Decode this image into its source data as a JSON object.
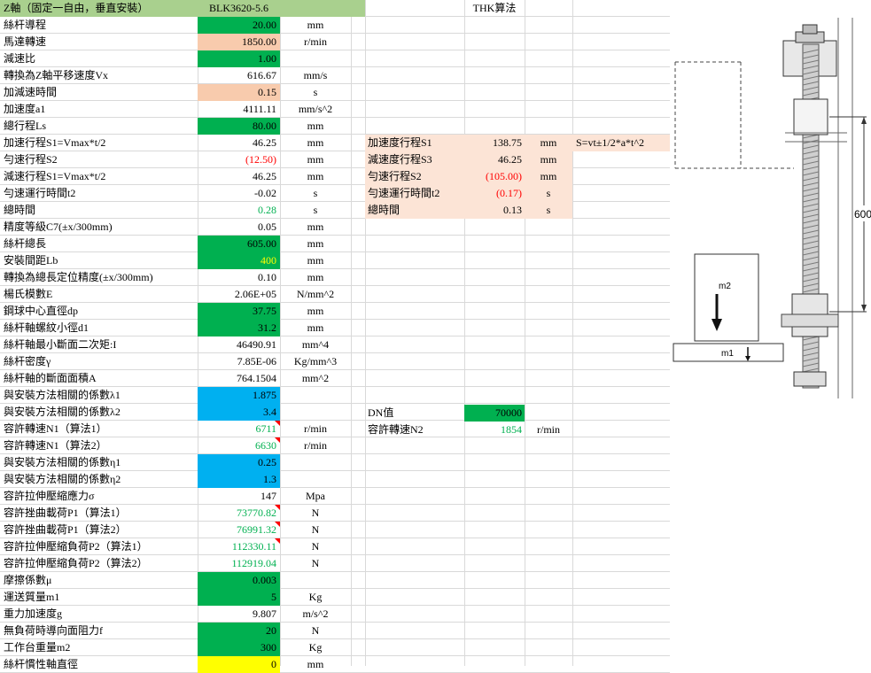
{
  "header": {
    "title": "Z軸（固定一自由，垂直安裝）",
    "model": "BLK3620-5.6",
    "thk_title": "THK算法"
  },
  "left_rows": [
    {
      "label": "絲杆導程",
      "value": "20.00",
      "unit": "mm",
      "style": "green"
    },
    {
      "label": "馬達轉速",
      "value": "1850.00",
      "unit": "r/min",
      "style": "orange"
    },
    {
      "label": "減速比",
      "value": "1.00",
      "unit": "",
      "style": "green"
    },
    {
      "label": "轉換為Z軸平移速度Vx",
      "value": "616.67",
      "unit": "mm/s",
      "style": ""
    },
    {
      "label": "加減速時間",
      "value": "0.15",
      "unit": "s",
      "style": "orange"
    },
    {
      "label": "加速度a1",
      "value": "4111.11",
      "unit": "mm/s^2",
      "style": ""
    },
    {
      "label": "總行程Ls",
      "value": "80.00",
      "unit": "mm",
      "style": "green"
    },
    {
      "label": "加速行程S1=Vmax*t/2",
      "value": "46.25",
      "unit": "mm",
      "style": ""
    },
    {
      "label": "勻速行程S2",
      "value": "(12.50)",
      "unit": "mm",
      "style": "red"
    },
    {
      "label": "減速行程S1=Vmax*t/2",
      "value": "46.25",
      "unit": "mm",
      "style": ""
    },
    {
      "label": "勻速運行時間t2",
      "value": "-0.02",
      "unit": "s",
      "style": ""
    },
    {
      "label": "總時間",
      "value": "0.28",
      "unit": "s",
      "style": "tgreen"
    },
    {
      "label": "精度等級C7(±x/300mm)",
      "value": "0.05",
      "unit": "mm",
      "style": ""
    },
    {
      "label": "絲杆總長",
      "value": "605.00",
      "unit": "mm",
      "style": "green"
    },
    {
      "label": "安裝間距Lb",
      "value": "400",
      "unit": "mm",
      "style": "green-yellow"
    },
    {
      "label": "轉換為總長定位精度(±x/300mm)",
      "value": "0.10",
      "unit": "mm",
      "style": ""
    },
    {
      "label": "楊氏模數E",
      "value": "2.06E+05",
      "unit": "N/mm^2",
      "style": ""
    },
    {
      "label": "鋼球中心直徑dp",
      "value": "37.75",
      "unit": "mm",
      "style": "green"
    },
    {
      "label": "絲杆軸螺紋小徑d1",
      "value": "31.2",
      "unit": "mm",
      "style": "green"
    },
    {
      "label": "絲杆軸最小斷面二次矩:I",
      "value": "46490.91",
      "unit": "mm^4",
      "style": ""
    },
    {
      "label": "絲杆密度γ",
      "value": "7.85E-06",
      "unit": "Kg/mm^3",
      "style": ""
    },
    {
      "label": "絲杆軸的斷面面積A",
      "value": "764.1504",
      "unit": "mm^2",
      "style": ""
    },
    {
      "label": "與安裝方法相關的係數λ1",
      "value": "1.875",
      "unit": "",
      "style": "blue"
    },
    {
      "label": "與安裝方法相關的係數λ2",
      "value": "3.4",
      "unit": "",
      "style": "blue"
    },
    {
      "label": "容許轉速N1（算法1）",
      "value": "6711",
      "unit": "r/min",
      "style": "tgreen-tri"
    },
    {
      "label": "容許轉速N1（算法2）",
      "value": "6630",
      "unit": "r/min",
      "style": "tgreen-tri"
    },
    {
      "label": "與安裝方法相關的係數η1",
      "value": "0.25",
      "unit": "",
      "style": "blue"
    },
    {
      "label": "與安裝方法相關的係數η2",
      "value": "1.3",
      "unit": "",
      "style": "blue"
    },
    {
      "label": "容許拉伸壓縮應力σ",
      "value": "147",
      "unit": "Mpa",
      "style": ""
    },
    {
      "label": "容許挫曲載荷P1（算法1）",
      "value": "73770.82",
      "unit": "N",
      "style": "tgreen-tri"
    },
    {
      "label": "容許挫曲載荷P1（算法2）",
      "value": "76991.32",
      "unit": "N",
      "style": "tgreen-tri"
    },
    {
      "label": "容許拉伸壓縮負荷P2（算法1）",
      "value": "112330.11",
      "unit": "N",
      "style": "tgreen-tri"
    },
    {
      "label": "容許拉伸壓縮負荷P2（算法2）",
      "value": "112919.04",
      "unit": "N",
      "style": "tgreen"
    },
    {
      "label": "摩擦係數μ",
      "value": "0.003",
      "unit": "",
      "style": "green"
    },
    {
      "label": "運送質量m1",
      "value": "5",
      "unit": "Kg",
      "style": "green"
    },
    {
      "label": "重力加速度g",
      "value": "9.807",
      "unit": "m/s^2",
      "style": ""
    },
    {
      "label": "無負荷時導向面阻力f",
      "value": "20",
      "unit": "N",
      "style": "green"
    },
    {
      "label": "工作台重量m2",
      "value": "300",
      "unit": "Kg",
      "style": "green"
    },
    {
      "label": "絲杆慣性軸直徑",
      "value": "0",
      "unit": "mm",
      "style": "yellow"
    }
  ],
  "thk_rows": [
    {
      "row": 7,
      "label": "加速度行程S1",
      "value": "138.75",
      "unit": "mm",
      "style": ""
    },
    {
      "row": 8,
      "label": "減速度行程S3",
      "value": "46.25",
      "unit": "mm",
      "style": ""
    },
    {
      "row": 9,
      "label": "勻速行程S2",
      "value": "(105.00)",
      "unit": "mm",
      "style": "red"
    },
    {
      "row": 10,
      "label": "勻速運行時間t2",
      "value": "(0.17)",
      "unit": "s",
      "style": "red"
    },
    {
      "row": 11,
      "label": "總時間",
      "value": "0.13",
      "unit": "s",
      "style": ""
    }
  ],
  "formula_note": "S=vt±1/2*a*t^2",
  "dn": {
    "label": "DN值",
    "value": "70000"
  },
  "n2": {
    "label": "容許轉速N2",
    "value": "1854",
    "unit": "r/min"
  },
  "drawing": {
    "dimension": "600",
    "mass_label_m2": "m2",
    "mass_label_m1": "m1"
  },
  "colors": {
    "green": "#00b050",
    "orange": "#f8cbad",
    "blue": "#00b0f0",
    "yellow": "#ffff00",
    "peach": "#fce4d6",
    "red": "#ff0000"
  }
}
